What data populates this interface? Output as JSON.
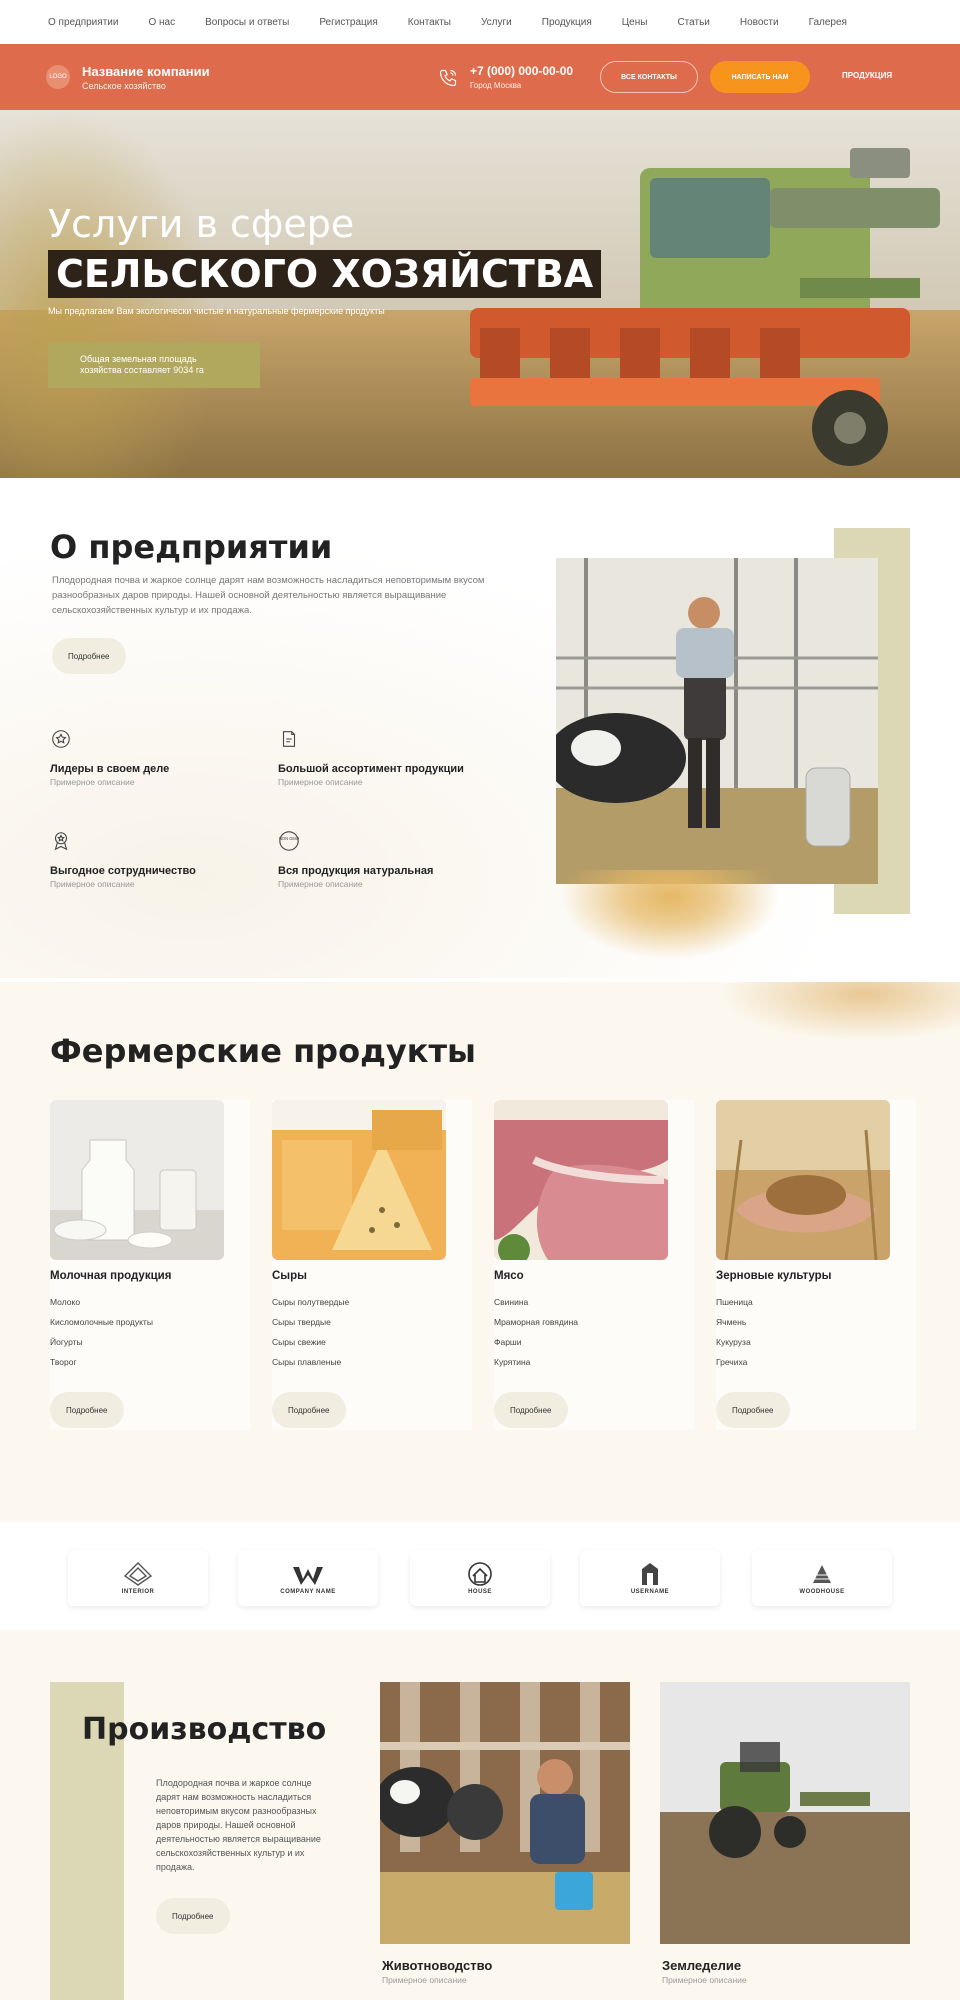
{
  "topnav": [
    "О предприятии",
    "О нас",
    "Вопросы и ответы",
    "Регистрация",
    "Контакты",
    "Услуги",
    "Продукция",
    "Цены",
    "Статьи",
    "Новости",
    "Галерея"
  ],
  "header": {
    "logo_text": "LOGO",
    "company_name": "Название компании",
    "company_sub": "Сельское хозяйство",
    "phone": "+7 (000) 000-00-00",
    "city": "Город Москва",
    "contacts_btn": "Все контакты",
    "write_btn": "Написать нам",
    "products_link": "Продукция"
  },
  "hero": {
    "title_line1": "Услуги в сфере",
    "title_line2": "СЕЛЬСКОГО ХОЗЯЙСТВА",
    "subtitle": "Мы предлагаем Вам экологически чистые и натуральные фермерские продукты",
    "badge_line1": "Общая земельная площадь",
    "badge_line2": "хозяйства составляет 9034 га"
  },
  "about": {
    "title": "О предприятии",
    "text": "Плодородная почва и жаркое солнце дарят нам возможность насладиться неповторимым вкусом разнообразных даров природы. Нашей основной деятельностью является выращивание сельскохозяйственных культур и их продажа.",
    "more_btn": "Подробнее",
    "features": [
      {
        "title": "Лидеры в своем деле",
        "desc": "Примерное описание",
        "icon": "badge-icon"
      },
      {
        "title": "Большой ассортимент продукции",
        "desc": "Примерное описание",
        "icon": "box-icon"
      },
      {
        "title": "Выгодное сотрудничество",
        "desc": "Примерное описание",
        "icon": "award-icon"
      },
      {
        "title": "Вся продукция натуральная",
        "desc": "Примерное описание",
        "icon": "non-gmo-icon"
      }
    ],
    "non_gmo_label": "NON GMO"
  },
  "products": {
    "title": "Фермерские продукты",
    "more_btn": "Подробнее",
    "items": [
      {
        "title": "Молочная продукция",
        "list": [
          "Молоко",
          "Кисломолочные продукты",
          "Йогурты",
          "Творог"
        ]
      },
      {
        "title": "Сыры",
        "list": [
          "Сыры полутвердые",
          "Сыры твердые",
          "Сыры свежие",
          "Сыры плавленые"
        ]
      },
      {
        "title": "Мясо",
        "list": [
          "Свинина",
          "Мраморная говядина",
          "Фарши",
          "Курятина"
        ]
      },
      {
        "title": "Зерновые культуры",
        "list": [
          "Пшеница",
          "Ячмень",
          "Кукуруза",
          "Гречиха"
        ]
      }
    ]
  },
  "partners": [
    {
      "name": "INTERIOR"
    },
    {
      "name": "COMPANY NAME"
    },
    {
      "name": "HOUSE"
    },
    {
      "name": "USERNAME"
    },
    {
      "name": "WOODHOUSE"
    }
  ],
  "production": {
    "title": "Производство",
    "text": "Плодородная почва и жаркое солнце дарят нам возможность насладиться неповторимым вкусом разнообразных даров природы. Нашей основной деятельностью является выращивание сельскохозяйственных культур и их продажа.",
    "more_btn": "Подробнее",
    "cards": [
      {
        "title": "Животноводство",
        "desc": "Примерное описание"
      },
      {
        "title": "Земледелие",
        "desc": "Примерное описание"
      }
    ]
  },
  "colors": {
    "header": "#de6b4b",
    "accent_orange": "#f7941d",
    "olive": "#b1a85d",
    "frame_beige": "#dcd7b4",
    "cream": "#fcf8ef"
  }
}
